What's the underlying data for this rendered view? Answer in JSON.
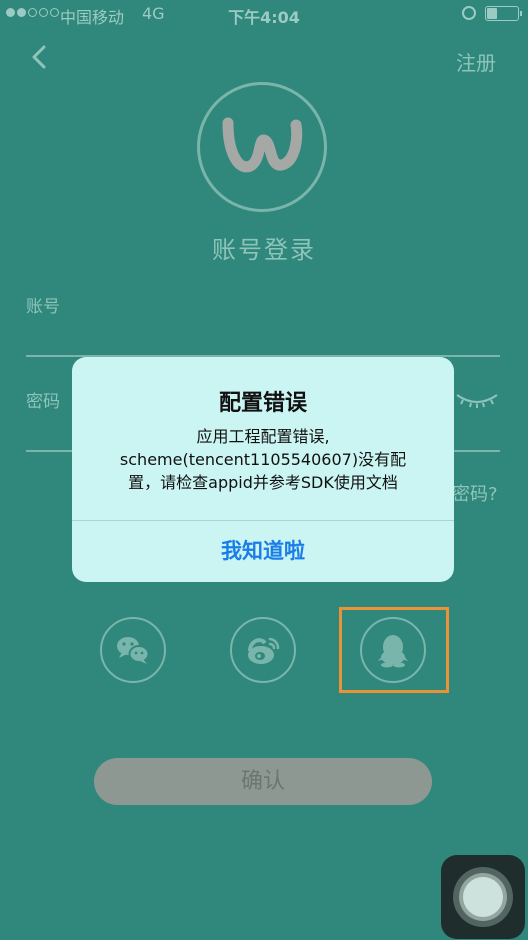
{
  "status_bar": {
    "signal_full": 2,
    "signal_total": 5,
    "carrier": "中国移动",
    "network": "4G",
    "time": "下午4:04",
    "icons": [
      "alarm-icon",
      "battery-icon"
    ]
  },
  "header": {
    "back_icon": "chevron-left-icon",
    "register_label": "注册"
  },
  "logo": {
    "icon": "w-logo-icon"
  },
  "page": {
    "title": "账号登录"
  },
  "form": {
    "account_label": "账号",
    "password_label": "密码",
    "password_toggle_icon": "eye-closed-icon",
    "forgot_label": "密码?"
  },
  "social": {
    "items": [
      {
        "name": "wechat",
        "icon": "wechat-icon"
      },
      {
        "name": "weibo",
        "icon": "weibo-icon"
      },
      {
        "name": "qq",
        "icon": "qq-icon"
      }
    ]
  },
  "confirm_label": "确认",
  "alert": {
    "title": "配置错误",
    "message_lines": [
      "应用工程配置错误,",
      "scheme(tencent1105540607)没有配",
      "置，请检查appid并参考SDK使用文档"
    ],
    "button_label": "我知道啦"
  },
  "colors": {
    "background": "#2f887b",
    "alert_background": "#cbf5f3",
    "alert_button": "#1a7de8",
    "highlight": "#e99236",
    "confirm_button": "#8d9893"
  }
}
